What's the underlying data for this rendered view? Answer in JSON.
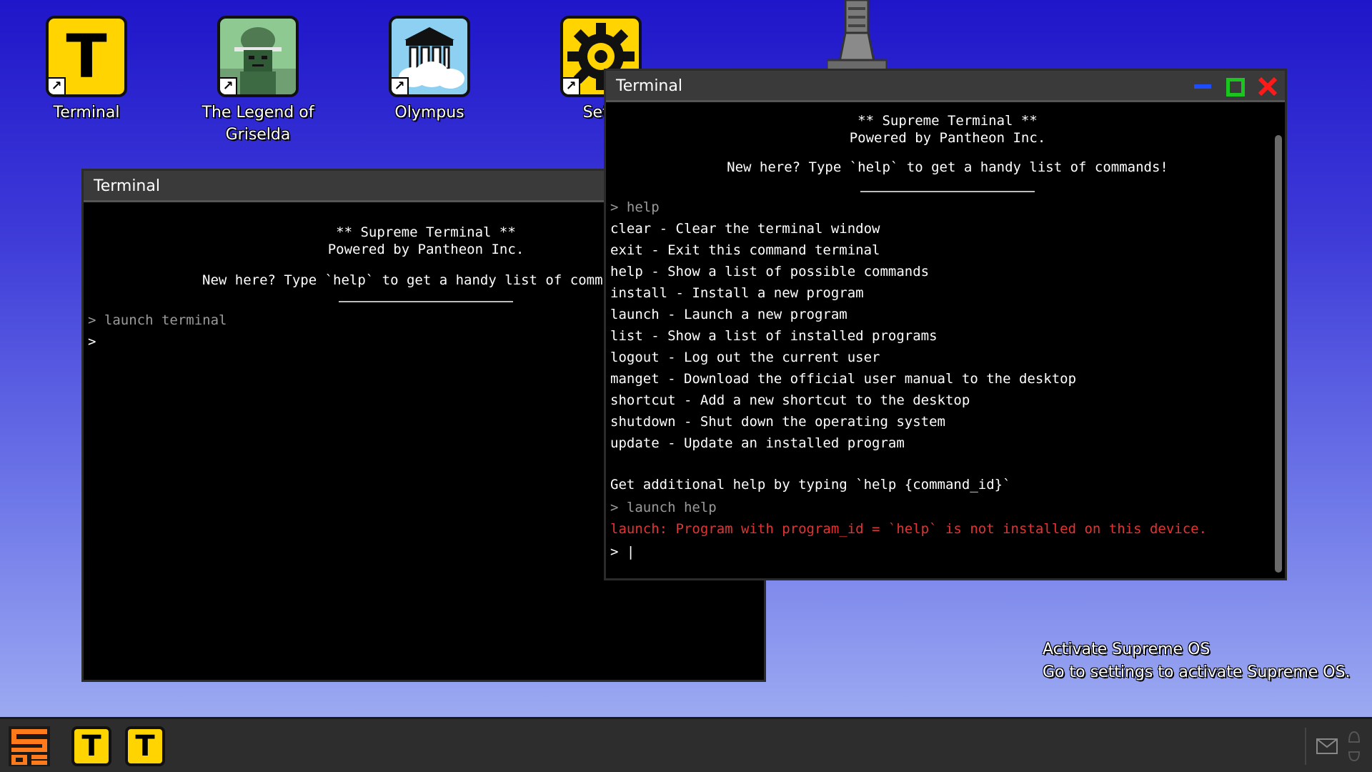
{
  "desktop": {
    "icons": [
      {
        "label": "Terminal",
        "icon": "terminal-t-icon"
      },
      {
        "label": "The Legend of Griselda",
        "icon": "soldier-portrait-icon"
      },
      {
        "label": "Olympus",
        "icon": "temple-cloud-icon"
      },
      {
        "label": "Setti",
        "icon": "settings-gear-icon"
      }
    ]
  },
  "back_terminal": {
    "title": "Terminal",
    "banner_title": "** Supreme Terminal **",
    "banner_sub": "Powered by Pantheon Inc.",
    "banner_help": "New here? Type `help` to get a handy list of comm",
    "lines": [
      "> launch terminal",
      ">"
    ]
  },
  "front_terminal": {
    "title": "Terminal",
    "banner_title": "** Supreme Terminal **",
    "banner_sub": "Powered by Pantheon Inc.",
    "banner_help": "New here? Type `help` to get a handy list of commands!",
    "command": "> help",
    "help_lines": [
      "clear - Clear the terminal window",
      "exit - Exit this command terminal",
      "help - Show a list of possible commands",
      "install - Install a new program",
      "launch - Launch a new program",
      "list - Show a list of installed programs",
      "logout - Log out the current user",
      "manget - Download the official user manual to the desktop",
      "shortcut - Add a new shortcut to the desktop",
      "shutdown - Shut down the operating system",
      "update - Update an installed program"
    ],
    "additional_help": "Get additional help by typing `help {command_id}`",
    "command2": "> launch help",
    "error": "launch: Program with program_id = `help` is not installed on this device.",
    "prompt": "> |"
  },
  "activation": {
    "line1": "Activate Supreme OS",
    "line2": "Go to settings to activate Supreme OS."
  },
  "taskbar": {
    "logo": "supreme-os-logo",
    "apps": [
      "T",
      "T"
    ]
  },
  "colors": {
    "accent_yellow": "#ffd400",
    "error_red": "#e23434",
    "minimize_blue": "#1e4cff",
    "maximize_green": "#19c51e",
    "close_red": "#ff1a1a"
  }
}
